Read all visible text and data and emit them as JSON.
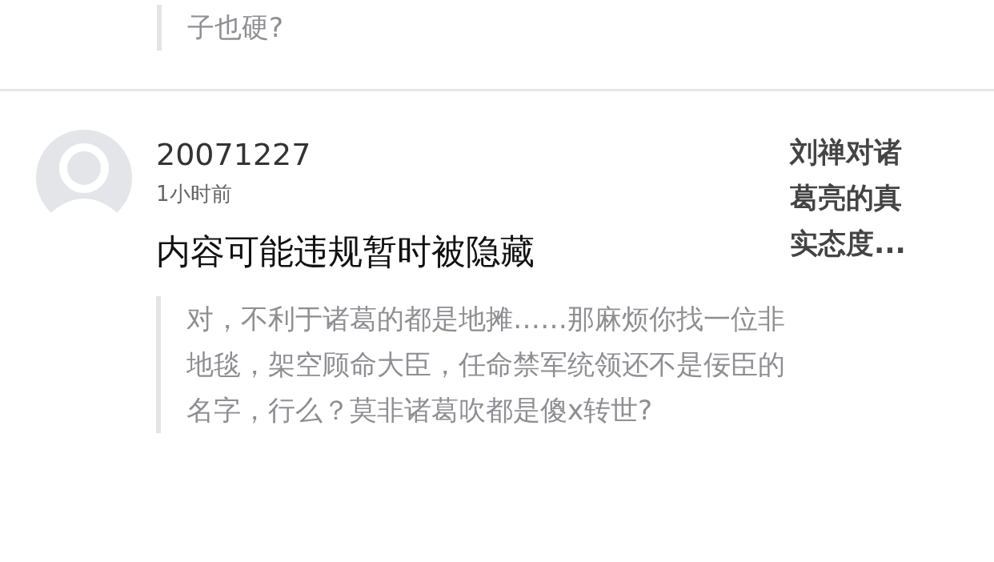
{
  "previous_quote": {
    "text": "子也硬?"
  },
  "comment": {
    "username": "20071227",
    "time": "1小时前",
    "content": "内容可能违规暂时被隐藏",
    "quote": "对，不利于诸葛的都是地摊……那麻烦你找一位非地毯，架空顾命大臣，任命禁军统领还不是佞臣的名字，行么？莫非诸葛吹都是傻x转世?",
    "thread_title": "刘禅对诸葛亮的真实态度..."
  }
}
